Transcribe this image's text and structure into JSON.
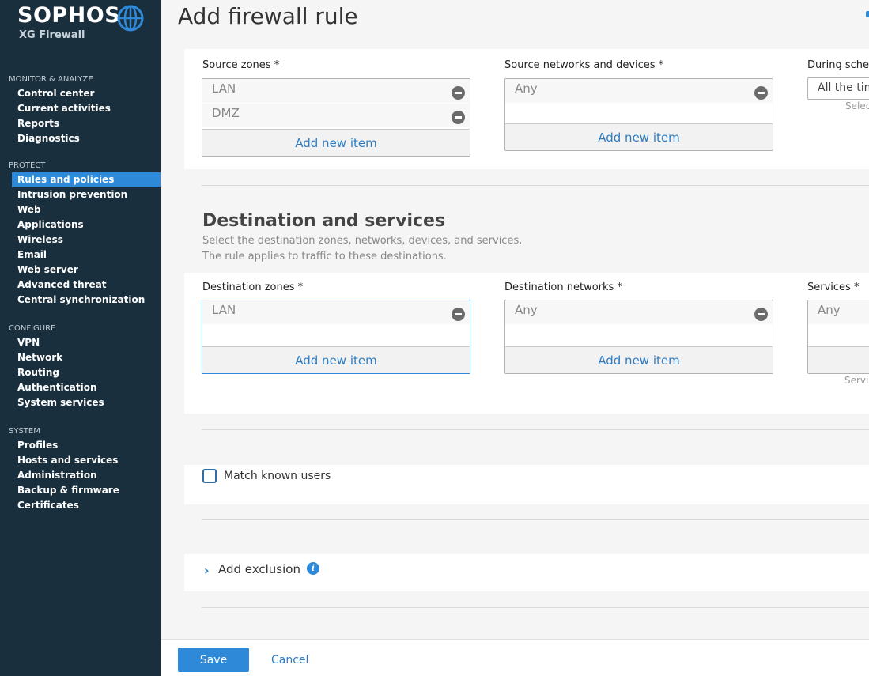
{
  "brand": {
    "name": "SOPHOS",
    "product": "XG Firewall"
  },
  "sidebar": {
    "sections": [
      {
        "heading": "MONITOR & ANALYZE",
        "items": [
          "Control center",
          "Current activities",
          "Reports",
          "Diagnostics"
        ]
      },
      {
        "heading": "PROTECT",
        "items": [
          "Rules and policies",
          "Intrusion prevention",
          "Web",
          "Applications",
          "Wireless",
          "Email",
          "Web server",
          "Advanced threat",
          "Central synchronization"
        ]
      },
      {
        "heading": "CONFIGURE",
        "items": [
          "VPN",
          "Network",
          "Routing",
          "Authentication",
          "System services"
        ]
      },
      {
        "heading": "SYSTEM",
        "items": [
          "Profiles",
          "Hosts and services",
          "Administration",
          "Backup & firmware",
          "Certificates"
        ]
      }
    ],
    "active_item": "Rules and policies"
  },
  "header": {
    "title": "Add firewall rule"
  },
  "source": {
    "zones_label": "Source zones *",
    "zones": [
      "LAN",
      "DMZ"
    ],
    "networks_label": "Source networks and devices *",
    "networks": [
      "Any"
    ],
    "schedule_label": "During schec",
    "schedule_value": "All the tim",
    "schedule_hint": "Selec",
    "add_label": "Add new item"
  },
  "destination": {
    "title": "Destination and services",
    "desc_line1": "Select the destination zones, networks, devices, and services.",
    "desc_line2": "The rule applies to traffic to these destinations.",
    "zones_label": "Destination zones *",
    "zones": [
      "LAN"
    ],
    "networks_label": "Destination networks *",
    "networks": [
      "Any"
    ],
    "services_label": "Services *",
    "services": [
      "Any"
    ],
    "services_hint": "Servic",
    "add_label": "Add new item"
  },
  "match_users": {
    "label": "Match known users",
    "checked": false
  },
  "exclusion": {
    "label": "Add exclusion",
    "info": "i"
  },
  "footer": {
    "save_label": "Save",
    "cancel_label": "Cancel"
  },
  "colors": {
    "sidebar_bg": "#1a2f3d",
    "accent": "#2e8ad8",
    "link": "#2e7dc2"
  }
}
